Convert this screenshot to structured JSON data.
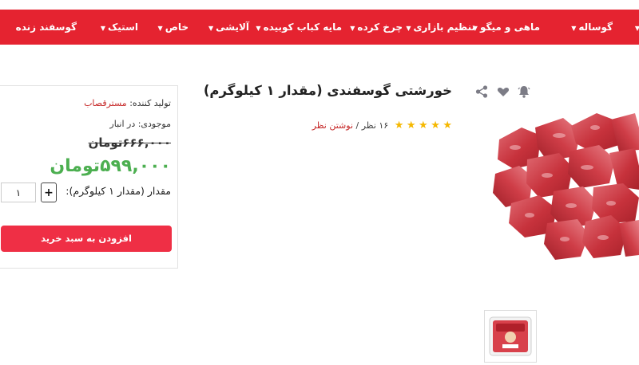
{
  "nav": {
    "items": [
      {
        "label": "گوساله",
        "has_dropdown": true
      },
      {
        "label": "ماهی و میگو",
        "has_dropdown": true
      },
      {
        "label": "تنظیم بازاری",
        "has_dropdown": true
      },
      {
        "label": "چرخ کرده",
        "has_dropdown": true
      },
      {
        "label": "مایه کباب کوبیده",
        "has_dropdown": true
      },
      {
        "label": "آلایشی",
        "has_dropdown": true
      },
      {
        "label": "خاص",
        "has_dropdown": true
      },
      {
        "label": "استیک",
        "has_dropdown": true
      },
      {
        "label": "گوسفند زنده",
        "has_dropdown": false
      }
    ],
    "colors": {
      "background": "#e52330",
      "text": "#ffffff"
    }
  },
  "product": {
    "title": "خورشتی گوسفندی (مقدار ۱ کیلوگرم)",
    "rating": {
      "stars": 5,
      "max": 5,
      "count_text": "۱۶ نظر",
      "separator": "/",
      "write_review": "نوشتن نظر"
    },
    "actions": [
      "bell-icon",
      "heart-icon",
      "share-icon"
    ]
  },
  "buy_box": {
    "producer_label": "تولید کننده:",
    "producer_value": "مسترقصاب",
    "stock_label": "موجودی:",
    "stock_value": "در انبار",
    "old_price": "۶۶۶,۰۰۰تومان",
    "new_price": "۵۹۹,۰۰۰تومان",
    "quantity_label": "مقدار (مقدار ۱ کیلوگرم):",
    "plus_label": "+",
    "quantity_value": "۱",
    "add_to_cart": "افزودن به سبد خرید"
  },
  "colors": {
    "accent": "#e52330",
    "button": "#ef2f45",
    "price_green": "#4caf50",
    "star": "#f5b800",
    "link_red": "#c62828"
  }
}
